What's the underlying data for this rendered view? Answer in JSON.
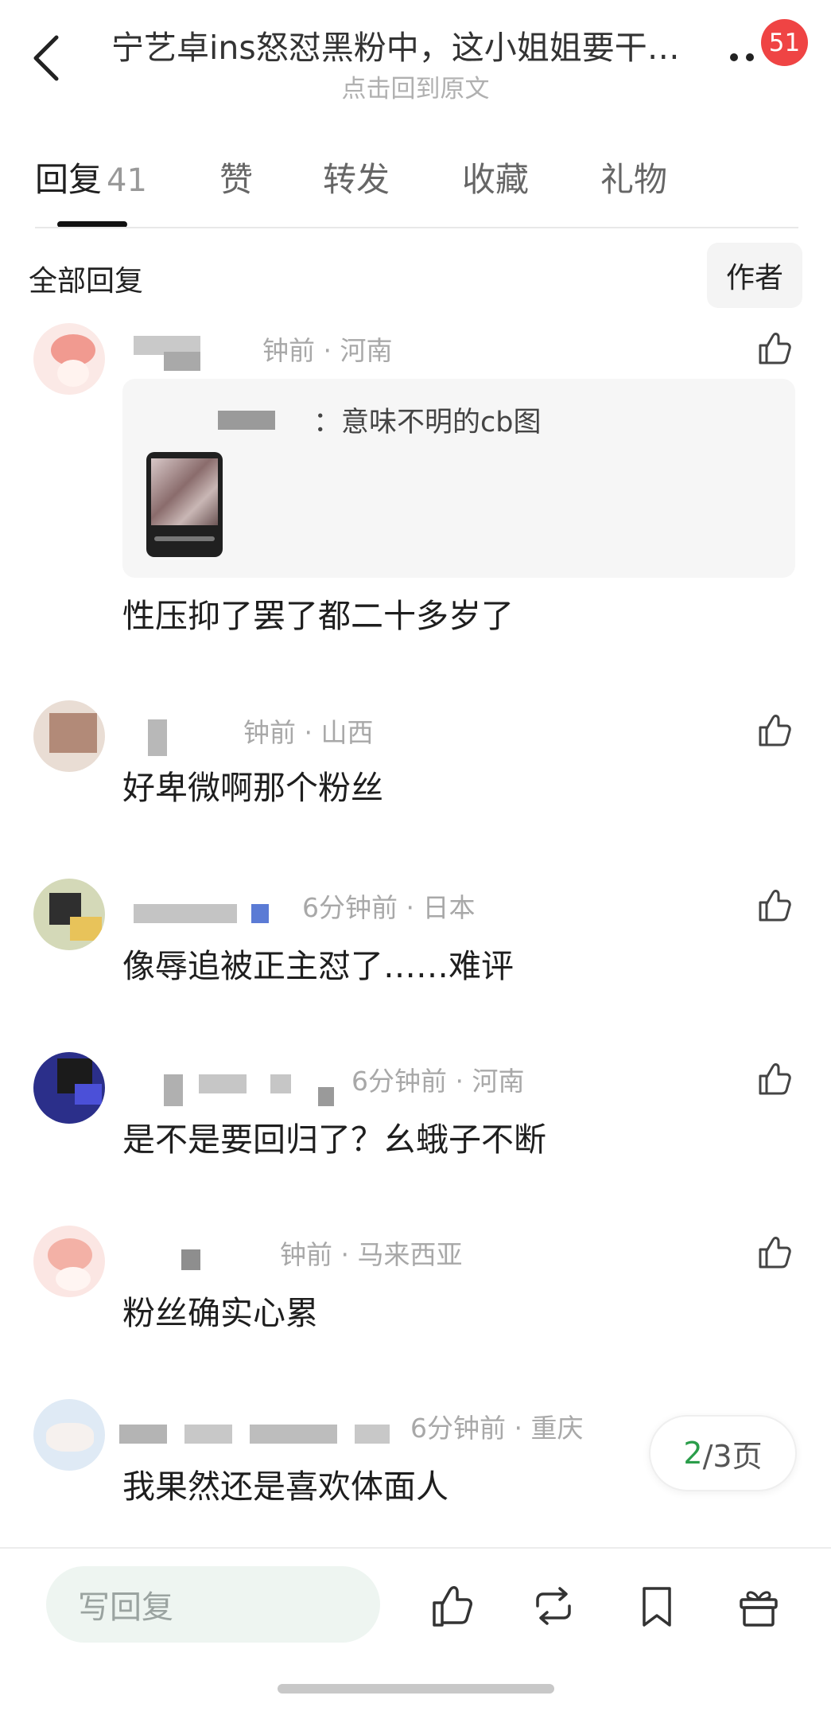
{
  "header": {
    "title": "宁艺卓ins怒怼黑粉中，这小姐姐要干…",
    "subtitle": "点击回到原文",
    "notification_count": "51"
  },
  "tabs": [
    {
      "label": "回复",
      "count": "41",
      "active": true
    },
    {
      "label": "赞"
    },
    {
      "label": "转发"
    },
    {
      "label": "收藏"
    },
    {
      "label": "礼物"
    }
  ],
  "section": {
    "title": "全部回复",
    "author_filter": "作者"
  },
  "comments": [
    {
      "meta": "钟前 · 河南",
      "quote": "：意味不明的cb图",
      "text": "性压抑了罢了都二十多岁了"
    },
    {
      "meta": "钟前 · 山西",
      "text": "好卑微啊那个粉丝"
    },
    {
      "meta": "6分钟前 · 日本",
      "text": "像辱追被正主怼了……难评"
    },
    {
      "meta": "6分钟前 · 河南",
      "text": "是不是要回归了？幺蛾子不断"
    },
    {
      "meta": "钟前 · 马来西亚",
      "text": "粉丝确实心累"
    },
    {
      "meta": "6分钟前 · 重庆",
      "text": "我果然还是喜欢体面人"
    }
  ],
  "pagination": {
    "current": "2",
    "total": "/3页"
  },
  "bottom_bar": {
    "reply_placeholder": "写回复",
    "icons": [
      "like-icon",
      "repost-icon",
      "bookmark-icon",
      "gift-icon"
    ]
  },
  "colors": {
    "accent_green": "#2a9d4a",
    "badge_red": "#ef4444",
    "reply_input_bg": "#eef5f1"
  }
}
